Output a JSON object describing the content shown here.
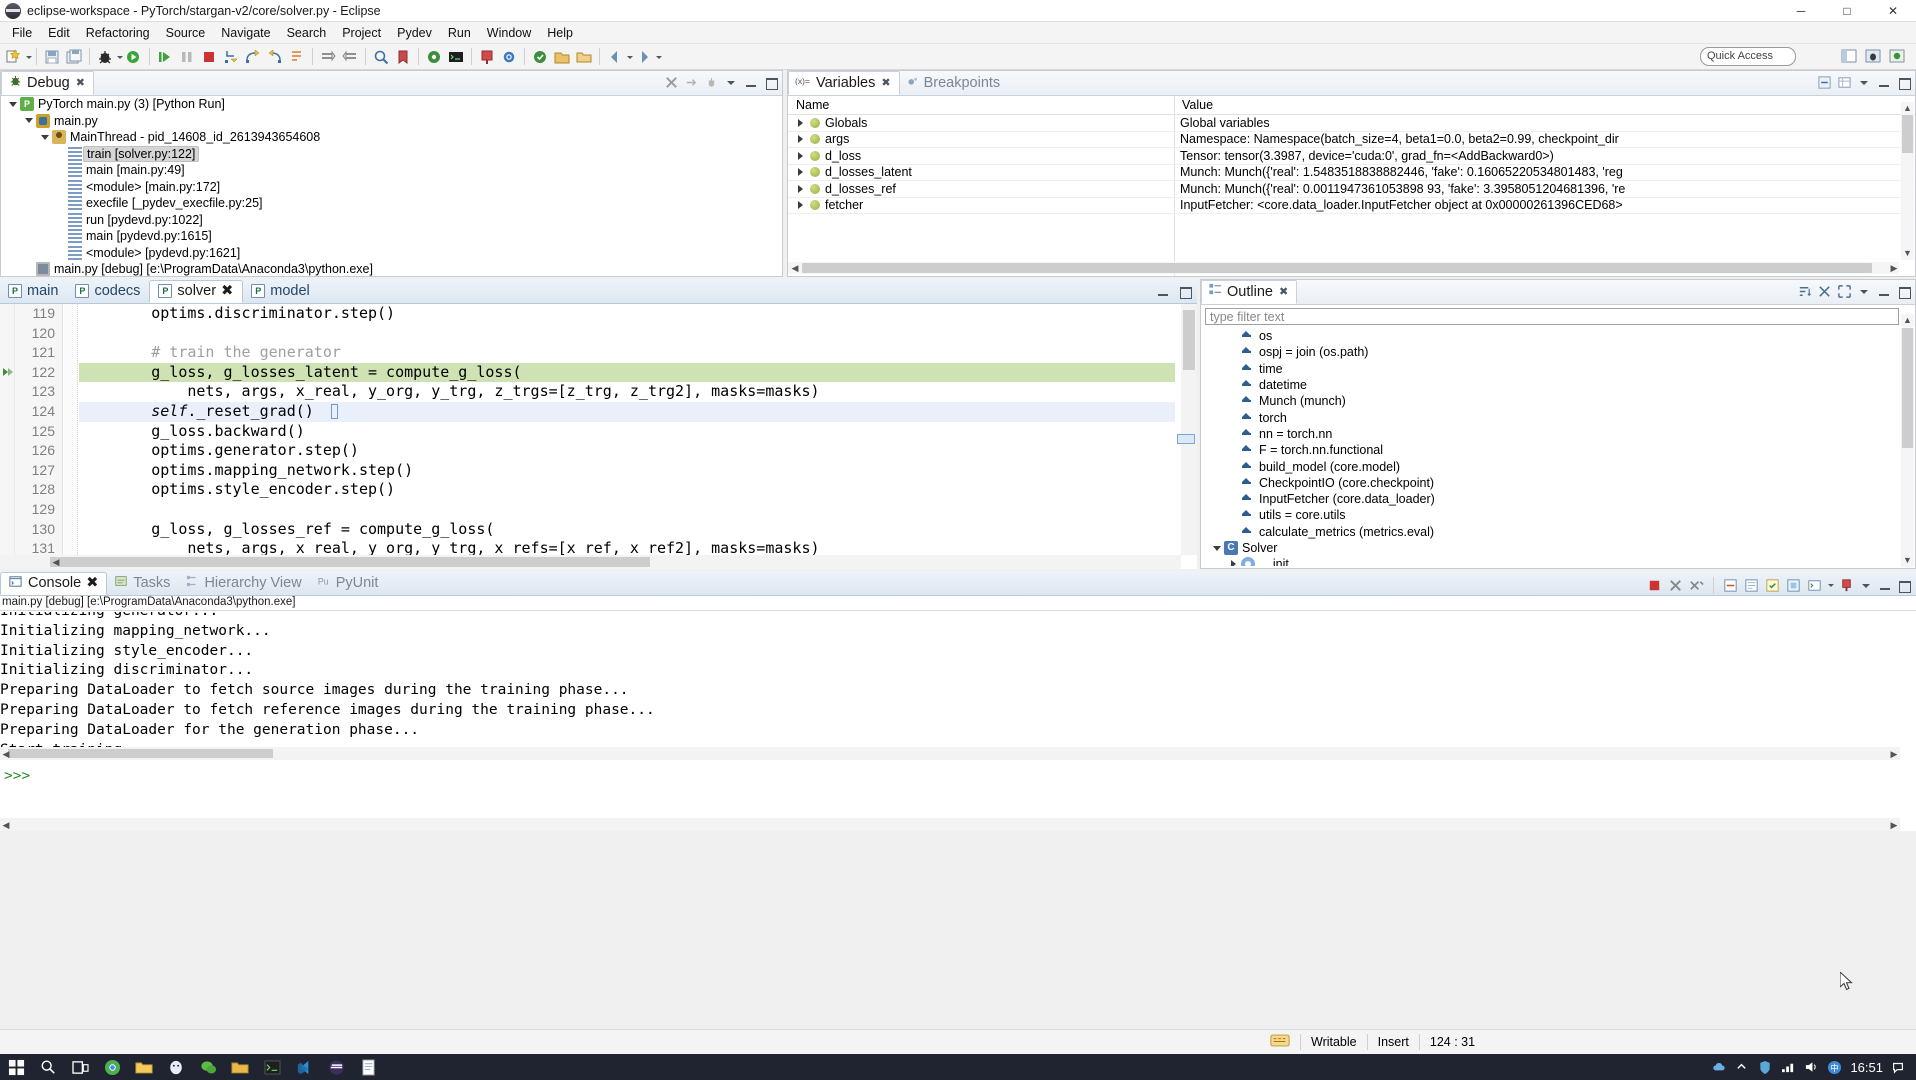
{
  "window": {
    "title": "eclipse-workspace - PyTorch/stargan-v2/core/solver.py - Eclipse",
    "icon": "eclipse-icon",
    "minimize": "─",
    "maximize": "□",
    "close": "✕"
  },
  "menubar": {
    "items": [
      "File",
      "Edit",
      "Refactoring",
      "Source",
      "Navigate",
      "Search",
      "Project",
      "Pydev",
      "Run",
      "Window",
      "Help"
    ]
  },
  "toolbar": {
    "quick_access": "Quick Access"
  },
  "debug_view": {
    "tab_label": "Debug",
    "tab_close": "✖",
    "tree": [
      {
        "indent": 0,
        "twisty": "open",
        "icon": "launch-config-icon",
        "label": "PyTorch main.py (3) [Python Run]",
        "selected": false
      },
      {
        "indent": 1,
        "twisty": "open",
        "icon": "python-file-icon",
        "label": "main.py",
        "selected": false
      },
      {
        "indent": 2,
        "twisty": "open",
        "icon": "thread-icon",
        "label": "MainThread - pid_14608_id_2613943654608",
        "selected": false
      },
      {
        "indent": 3,
        "twisty": "none",
        "icon": "stack-frame-icon",
        "label": "train [solver.py:122]",
        "selected": true
      },
      {
        "indent": 3,
        "twisty": "none",
        "icon": "stack-frame-icon",
        "label": "main [main.py:49]",
        "selected": false
      },
      {
        "indent": 3,
        "twisty": "none",
        "icon": "stack-frame-icon",
        "label": "<module> [main.py:172]",
        "selected": false
      },
      {
        "indent": 3,
        "twisty": "none",
        "icon": "stack-frame-icon",
        "label": "execfile [_pydev_execfile.py:25]",
        "selected": false
      },
      {
        "indent": 3,
        "twisty": "none",
        "icon": "stack-frame-icon",
        "label": "run [pydevd.py:1022]",
        "selected": false
      },
      {
        "indent": 3,
        "twisty": "none",
        "icon": "stack-frame-icon",
        "label": "main [pydevd.py:1615]",
        "selected": false
      },
      {
        "indent": 3,
        "twisty": "none",
        "icon": "stack-frame-icon",
        "label": "<module> [pydevd.py:1621]",
        "selected": false
      },
      {
        "indent": 1,
        "twisty": "none",
        "icon": "process-icon",
        "label": "main.py [debug] [e:\\ProgramData\\Anaconda3\\python.exe]",
        "selected": false
      }
    ]
  },
  "variables_view": {
    "tabs": [
      {
        "label": "Variables",
        "active": true,
        "close": "✖",
        "icon": "variables-icon"
      },
      {
        "label": "Breakpoints",
        "active": false,
        "icon": "breakpoints-icon"
      }
    ],
    "columns": [
      "Name",
      "Value"
    ],
    "rows": [
      {
        "name": "Globals",
        "value": "Global variables"
      },
      {
        "name": "args",
        "value": "Namespace: Namespace(batch_size=4, beta1=0.0, beta2=0.99, checkpoint_dir"
      },
      {
        "name": "d_loss",
        "value": "Tensor: tensor(3.3987, device='cuda:0', grad_fn=<AddBackward0>)"
      },
      {
        "name": "d_losses_latent",
        "value": "Munch: Munch({'real': 1.5483518838882446, 'fake': 0.16065220534801483, 'reg"
      },
      {
        "name": "d_losses_ref",
        "value": "Munch: Munch({'real': 0.0011947361053898 93, 'fake': 3.3958051204681396, 're"
      },
      {
        "name": "fetcher",
        "value": "InputFetcher: <core.data_loader.InputFetcher object at 0x00000261396CED68>"
      }
    ]
  },
  "editor": {
    "tabs": [
      {
        "label": "main",
        "active": false
      },
      {
        "label": "codecs",
        "active": false
      },
      {
        "label": "solver",
        "active": true,
        "close": "✖"
      },
      {
        "label": "model",
        "active": false
      }
    ],
    "lines": [
      {
        "num": "119",
        "text": "        optims.discriminator.step()",
        "style": "normal",
        "marker": ""
      },
      {
        "num": "120",
        "text": "",
        "style": "normal",
        "marker": ""
      },
      {
        "num": "121",
        "text": "        # train the generator",
        "style": "comment",
        "marker": ""
      },
      {
        "num": "122",
        "text": "        g_loss, g_losses_latent = compute_g_loss(",
        "style": "exec",
        "marker": "current-instruction-pointer"
      },
      {
        "num": "123",
        "text": "            nets, args, x_real, y_org, y_trg, z_trgs=[z_trg, z_trg2], masks=masks)",
        "style": "normal",
        "marker": ""
      },
      {
        "num": "124",
        "text": "        self._reset_grad()",
        "style": "cursorline",
        "marker": ""
      },
      {
        "num": "125",
        "text": "        g_loss.backward()",
        "style": "normal",
        "marker": ""
      },
      {
        "num": "126",
        "text": "        optims.generator.step()",
        "style": "normal",
        "marker": ""
      },
      {
        "num": "127",
        "text": "        optims.mapping_network.step()",
        "style": "normal",
        "marker": ""
      },
      {
        "num": "128",
        "text": "        optims.style_encoder.step()",
        "style": "normal",
        "marker": ""
      },
      {
        "num": "129",
        "text": "",
        "style": "normal",
        "marker": ""
      },
      {
        "num": "130",
        "text": "        g_loss, g_losses_ref = compute_g_loss(",
        "style": "normal",
        "marker": ""
      },
      {
        "num": "131",
        "text": "            nets, args, x_real, y_org, y_trg, x_refs=[x_ref, x_ref2], masks=masks)",
        "style": "normal",
        "marker": ""
      }
    ]
  },
  "outline_view": {
    "tab_label": "Outline",
    "tab_close": "✖",
    "filter_placeholder": "type filter text",
    "items": [
      {
        "indent": 1,
        "arrow": "none",
        "icon": "import-icon",
        "label": "os"
      },
      {
        "indent": 1,
        "arrow": "none",
        "icon": "import-icon",
        "label": "ospj = join (os.path)"
      },
      {
        "indent": 1,
        "arrow": "none",
        "icon": "import-icon",
        "label": "time"
      },
      {
        "indent": 1,
        "arrow": "none",
        "icon": "import-icon",
        "label": "datetime"
      },
      {
        "indent": 1,
        "arrow": "none",
        "icon": "import-icon",
        "label": "Munch (munch)"
      },
      {
        "indent": 1,
        "arrow": "none",
        "icon": "import-icon",
        "label": "torch"
      },
      {
        "indent": 1,
        "arrow": "none",
        "icon": "import-icon",
        "label": "nn = torch.nn"
      },
      {
        "indent": 1,
        "arrow": "none",
        "icon": "import-icon",
        "label": "F = torch.nn.functional"
      },
      {
        "indent": 1,
        "arrow": "none",
        "icon": "import-icon",
        "label": "build_model (core.model)"
      },
      {
        "indent": 1,
        "arrow": "none",
        "icon": "import-icon",
        "label": "CheckpointIO (core.checkpoint)"
      },
      {
        "indent": 1,
        "arrow": "none",
        "icon": "import-icon",
        "label": "InputFetcher (core.data_loader)"
      },
      {
        "indent": 1,
        "arrow": "none",
        "icon": "import-icon",
        "label": "utils = core.utils"
      },
      {
        "indent": 1,
        "arrow": "none",
        "icon": "import-icon",
        "label": "calculate_metrics (metrics.eval)"
      },
      {
        "indent": 0,
        "arrow": "open",
        "icon": "class-icon",
        "label": "Solver"
      },
      {
        "indent": 1,
        "arrow": "closed",
        "icon": "method-icon",
        "label": "__init__"
      }
    ]
  },
  "console_view": {
    "tabs": [
      {
        "label": "Console",
        "active": true,
        "close": "✖",
        "icon": "console-icon"
      },
      {
        "label": "Tasks",
        "active": false,
        "icon": "tasks-icon"
      },
      {
        "label": "Hierarchy View",
        "active": false,
        "icon": "hierarchy-icon"
      },
      {
        "label": "PyUnit",
        "active": false,
        "icon": "pyunit-icon"
      }
    ],
    "header": "main.py [debug] [e:\\ProgramData\\Anaconda3\\python.exe]",
    "lines": [
      "Initializing generator...",
      "Initializing mapping_network...",
      "Initializing style_encoder...",
      "Initializing discriminator...",
      "Preparing DataLoader to fetch source images during the training phase...",
      "Preparing DataLoader to fetch reference images during the training phase...",
      "Preparing DataLoader for the generation phase...",
      "Start training..."
    ],
    "prompt": ">>>"
  },
  "status_bar": {
    "writable": "Writable",
    "insert_mode": "Insert",
    "position": "124 : 31",
    "lock_icon": "keyboard-icon"
  },
  "taskbar": {
    "clock": "16:51",
    "start_icon": "start-icon",
    "search_icon": "search-icon",
    "taskview_icon": "task-view-icon"
  },
  "colors": {
    "exec_line": "#cfe2b3",
    "cursor_line": "#e9f0fb",
    "selection": "#d6d6d6",
    "accent": "#3c6ea5",
    "comment": "#9f9f9f",
    "prompt_green": "#2e8b2e"
  }
}
